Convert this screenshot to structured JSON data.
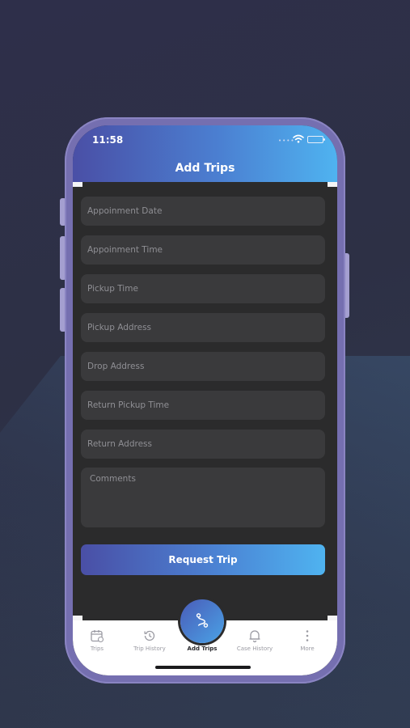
{
  "status_bar": {
    "time": "11:58"
  },
  "header": {
    "title": "Add Trips"
  },
  "form": {
    "fields": [
      {
        "placeholder": "Appoinment Date"
      },
      {
        "placeholder": "Appoinment Time"
      },
      {
        "placeholder": "Pickup Time"
      },
      {
        "placeholder": "Pickup Address"
      },
      {
        "placeholder": "Drop Address"
      },
      {
        "placeholder": "Return Pickup Time"
      },
      {
        "placeholder": "Return Address"
      }
    ],
    "comments_placeholder": "Comments",
    "submit_label": "Request Trip"
  },
  "tabbar": {
    "tabs": [
      {
        "label": "Trips",
        "icon": "calendar-icon"
      },
      {
        "label": "Trip History",
        "icon": "history-icon"
      },
      {
        "label": "Add Trips",
        "icon": "route-icon",
        "active": true
      },
      {
        "label": "Case History",
        "icon": "bell-icon"
      },
      {
        "label": "More",
        "icon": "more-vertical-icon"
      }
    ]
  },
  "colors": {
    "accent_start": "#4a4fa6",
    "accent_end": "#4fb3f0",
    "phone_frame": "#756fb0",
    "field_bg": "#3a3a3c",
    "screen_bg": "#2b2b2c"
  }
}
